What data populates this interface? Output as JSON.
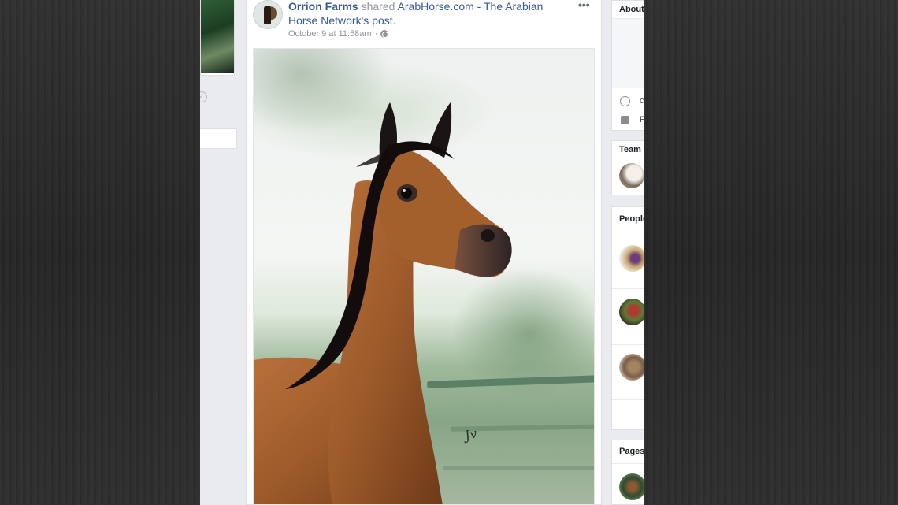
{
  "post": {
    "author": "Orrion Farms",
    "shared_word": " shared ",
    "shared_source": "ArabHorse.com - The Arabian Horse Network",
    "shared_suffix": "'s post.",
    "timestamp": "October 9 at 11:58am",
    "separator": "·",
    "more_label": "•••",
    "signature": "Jv"
  },
  "sidebar": {
    "about": {
      "title": "About",
      "row1_text": "c",
      "row2_text": "F"
    },
    "team": {
      "title": "Team M"
    },
    "people": {
      "title": "People"
    },
    "pages": {
      "title": "Pages"
    }
  },
  "colors": {
    "link_blue": "#365899",
    "meta_gray": "#90949c",
    "feed_bg": "#e9ebee"
  },
  "icons": [
    "globe-icon",
    "more-options-icon",
    "check-circle-icon"
  ]
}
